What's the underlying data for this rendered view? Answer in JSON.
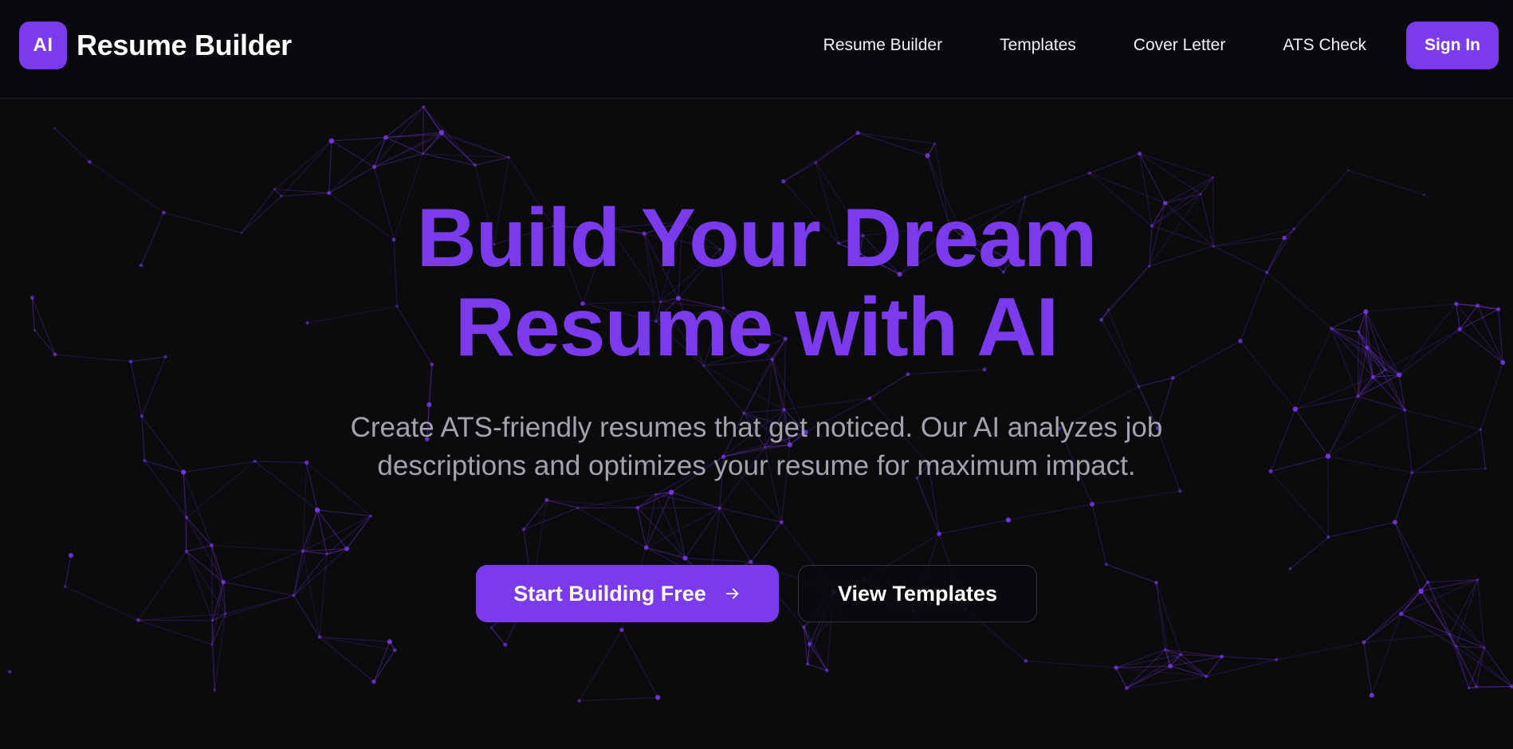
{
  "nav": {
    "logo_text": "AI",
    "brand_name": "Resume Builder",
    "links": [
      "Resume Builder",
      "Templates",
      "Cover Letter",
      "ATS Check"
    ],
    "signin_label": "Sign In"
  },
  "hero": {
    "title_line1": "Build Your Dream",
    "title_line2": "Resume with AI",
    "subtitle": "Create ATS-friendly resumes that get noticed. Our AI analyzes job descriptions and optimizes your resume for maximum impact.",
    "primary_cta": "Start Building Free",
    "primary_cta_icon": "arrow-right-icon",
    "secondary_cta": "View Templates"
  },
  "colors": {
    "background": "#0b0b0e",
    "accent": "#7c3aed",
    "subtitle": "#a3a3ad",
    "network_line": "#7c3aed"
  }
}
